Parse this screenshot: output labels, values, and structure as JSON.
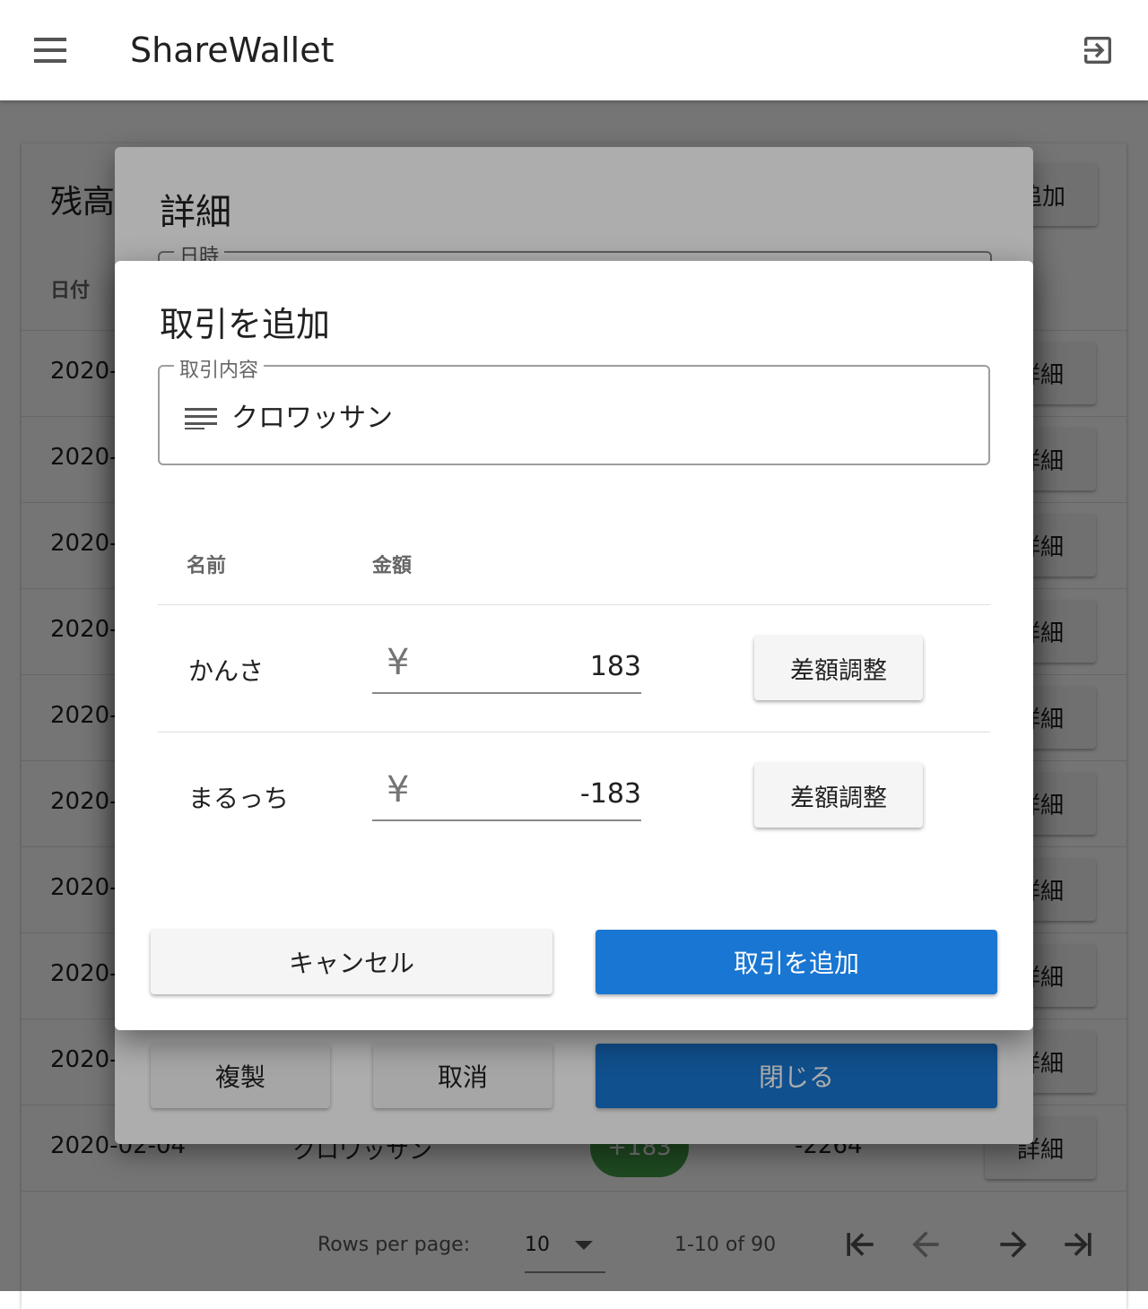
{
  "app": {
    "title": "ShareWallet"
  },
  "page": {
    "title": "残高",
    "add_button": "追加",
    "col_date": "日付",
    "rows": [
      {
        "date": "2020-"
      },
      {
        "date": "2020-"
      },
      {
        "date": "2020-"
      },
      {
        "date": "2020-"
      },
      {
        "date": "2020-"
      },
      {
        "date": "2020-"
      },
      {
        "date": "2020-"
      },
      {
        "date": "2020-"
      },
      {
        "date": "2020-"
      }
    ],
    "detail_label": "詳細",
    "last_row": {
      "date": "2020-02-04",
      "item": "クロワッサン",
      "amount": "+183",
      "balance": "-2264",
      "detail": "詳細"
    },
    "footer": {
      "rows_per_page_label": "Rows per page:",
      "rows_per_page": "10",
      "range": "1-10 of 90"
    }
  },
  "detail_dialog": {
    "title": "詳細",
    "date_label": "日時",
    "duplicate_button": "複製",
    "cancel_button": "取消",
    "close_button": "閉じる"
  },
  "add_dialog": {
    "title": "取引を追加",
    "description_label": "取引内容",
    "description_value": "クロワッサン",
    "col_name": "名前",
    "col_amount": "金額",
    "currency_symbol": "¥",
    "members": [
      {
        "name": "かんさ",
        "amount": "183",
        "adjust_label": "差額調整"
      },
      {
        "name": "まるっち",
        "amount": "-183",
        "adjust_label": "差額調整"
      }
    ],
    "cancel_button": "キャンセル",
    "submit_button": "取引を追加"
  },
  "colors": {
    "primary": "#1976d2",
    "positive": "#43a047"
  }
}
